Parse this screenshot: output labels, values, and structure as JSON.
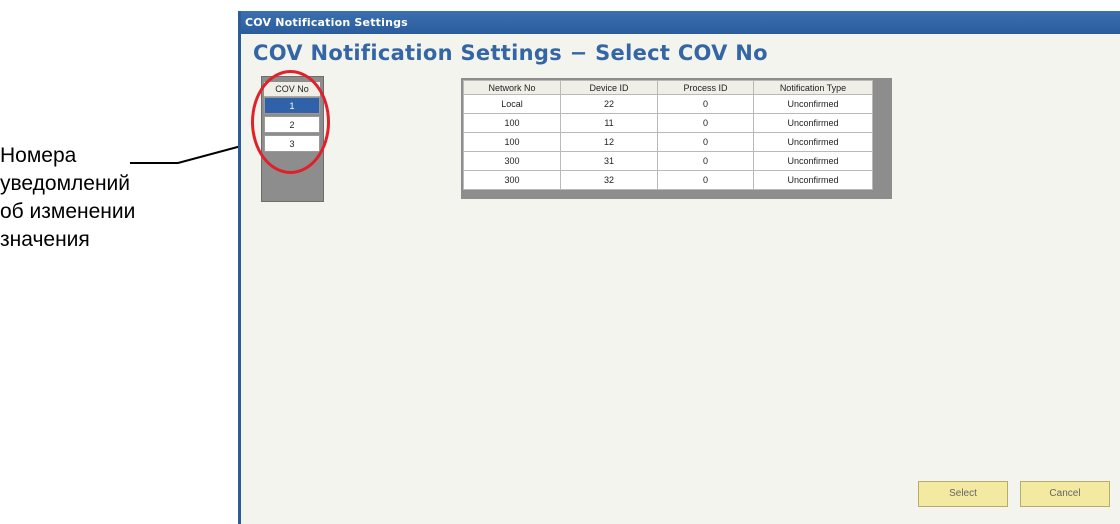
{
  "annotation": {
    "lines": [
      "Номера",
      "уведомлений",
      "об изменении",
      "значения"
    ]
  },
  "window": {
    "title": "COV Notification Settings",
    "heading": "COV Notification Settings  −  Select COV No"
  },
  "cov_list": {
    "header": "COV No",
    "items": [
      "1",
      "2",
      "3"
    ],
    "selected": "1"
  },
  "table": {
    "columns": [
      "Network No",
      "Device ID",
      "Process ID",
      "Notification Type"
    ],
    "rows": [
      [
        "Local",
        "22",
        "0",
        "Unconfirmed"
      ],
      [
        "100",
        "11",
        "0",
        "Unconfirmed"
      ],
      [
        "100",
        "12",
        "0",
        "Unconfirmed"
      ],
      [
        "300",
        "31",
        "0",
        "Unconfirmed"
      ],
      [
        "300",
        "32",
        "0",
        "Unconfirmed"
      ]
    ]
  },
  "buttons": {
    "select": "Select",
    "cancel": "Cancel"
  },
  "colors": {
    "title_bar": "#2b5d9c",
    "selection": "#2f62a8",
    "highlight_ring": "#e0202a",
    "button": "#f3e9a0"
  }
}
